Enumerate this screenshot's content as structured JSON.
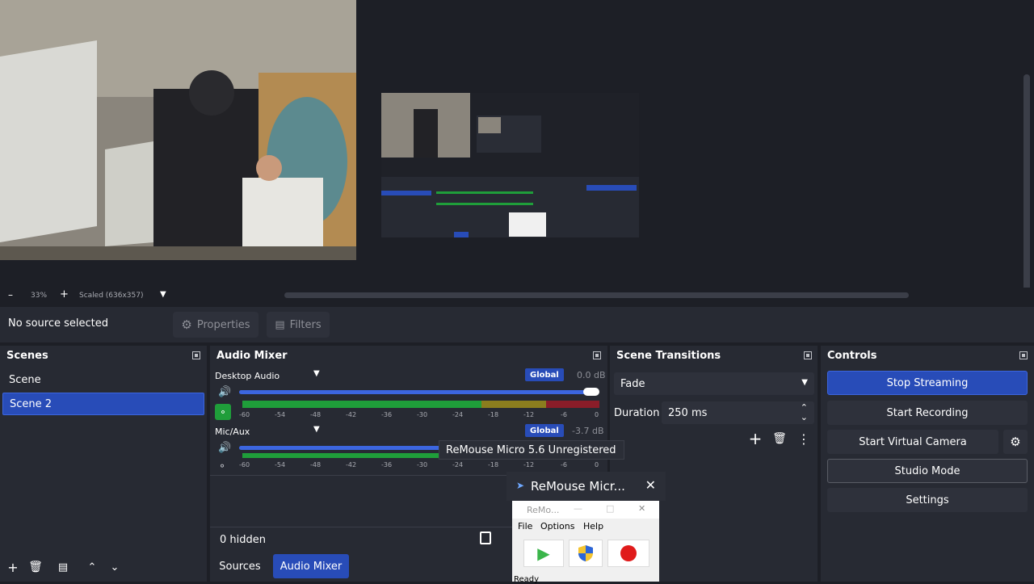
{
  "preview": {
    "zoom": "33%",
    "scale_label": "Scaled (636x357)"
  },
  "source_toolbar": {
    "status": "No source selected",
    "properties_label": "Properties",
    "filters_label": "Filters"
  },
  "scenes": {
    "title": "Scenes",
    "items": [
      {
        "label": "Scene",
        "selected": false
      },
      {
        "label": "Scene 2",
        "selected": true
      }
    ]
  },
  "audio_mixer": {
    "title": "Audio Mixer",
    "channels": [
      {
        "name": "Desktop Audio",
        "badge": "Global",
        "db": "0.0 dB",
        "volume": 1.0
      },
      {
        "name": "Mic/Aux",
        "badge": "Global",
        "db": "-3.7 dB",
        "volume": 0.6
      }
    ],
    "ticks": [
      "-60",
      "-54",
      "-48",
      "-42",
      "-36",
      "-30",
      "-24",
      "-18",
      "-12",
      "-6",
      "0"
    ],
    "hidden_label": "0 hidden",
    "tooltip": "ReMouse Micro 5.6 Unregistered"
  },
  "bottom_tabs": {
    "sources": "Sources",
    "audio_mixer": "Audio Mixer"
  },
  "scene_transitions": {
    "title": "Scene Transitions",
    "transition": "Fade",
    "duration_label": "Duration",
    "duration_value": "250 ms"
  },
  "controls": {
    "title": "Controls",
    "stop_streaming": "Stop Streaming",
    "start_recording": "Start Recording",
    "start_virtual_camera": "Start Virtual Camera",
    "studio_mode": "Studio Mode",
    "settings": "Settings"
  },
  "remouse": {
    "title": "ReMouse Micr...",
    "inner_title": "ReMo...",
    "menu": [
      "File",
      "Options",
      "Help"
    ],
    "status": "Ready"
  },
  "colors": {
    "accent": "#284cb8",
    "meter_green": "#1f9e3a",
    "meter_yellow": "#8b7d1e",
    "meter_red": "#8a1d29"
  }
}
